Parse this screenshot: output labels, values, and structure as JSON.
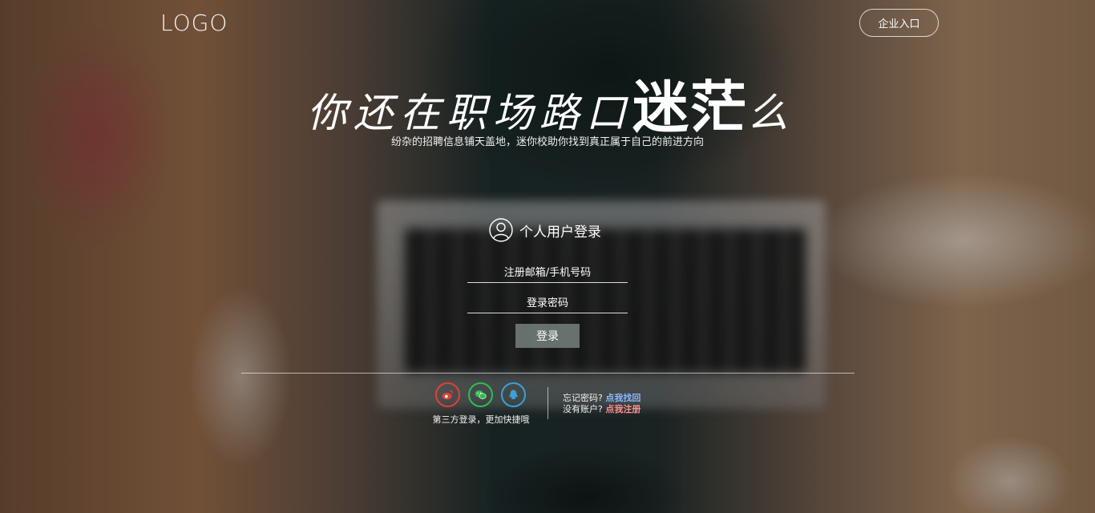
{
  "header": {
    "logo_text": "LOGO",
    "enterprise_entry_label": "企业入口"
  },
  "hero": {
    "headline_part1": "你还在职场路口",
    "headline_emphasis": "迷茫",
    "headline_end": "么",
    "subline": "纷杂的招聘信息铺天盖地，迷你校助你找到真正属于自己的前进方向"
  },
  "login": {
    "title": "个人用户登录",
    "email_placeholder": "注册邮箱/手机号码",
    "password_placeholder": "登录密码",
    "submit_label": "登录"
  },
  "third_party": {
    "caption": "第三方登录，更加快捷哦",
    "providers": [
      {
        "icon": "weibo-icon",
        "color": "#e0403a"
      },
      {
        "icon": "wechat-icon",
        "color": "#2bc04e"
      },
      {
        "icon": "qq-icon",
        "color": "#3d9fd8"
      }
    ]
  },
  "help": {
    "forgot_text": "忘记密码?",
    "forgot_link": "点我找回",
    "signup_text": "没有账户?",
    "signup_link": "点我注册"
  },
  "colors": {
    "weibo": "#e0403a",
    "wechat": "#2bc04e",
    "qq": "#3d9fd8",
    "link_blue": "#8ab8ff",
    "link_red": "#ff8f8f"
  }
}
